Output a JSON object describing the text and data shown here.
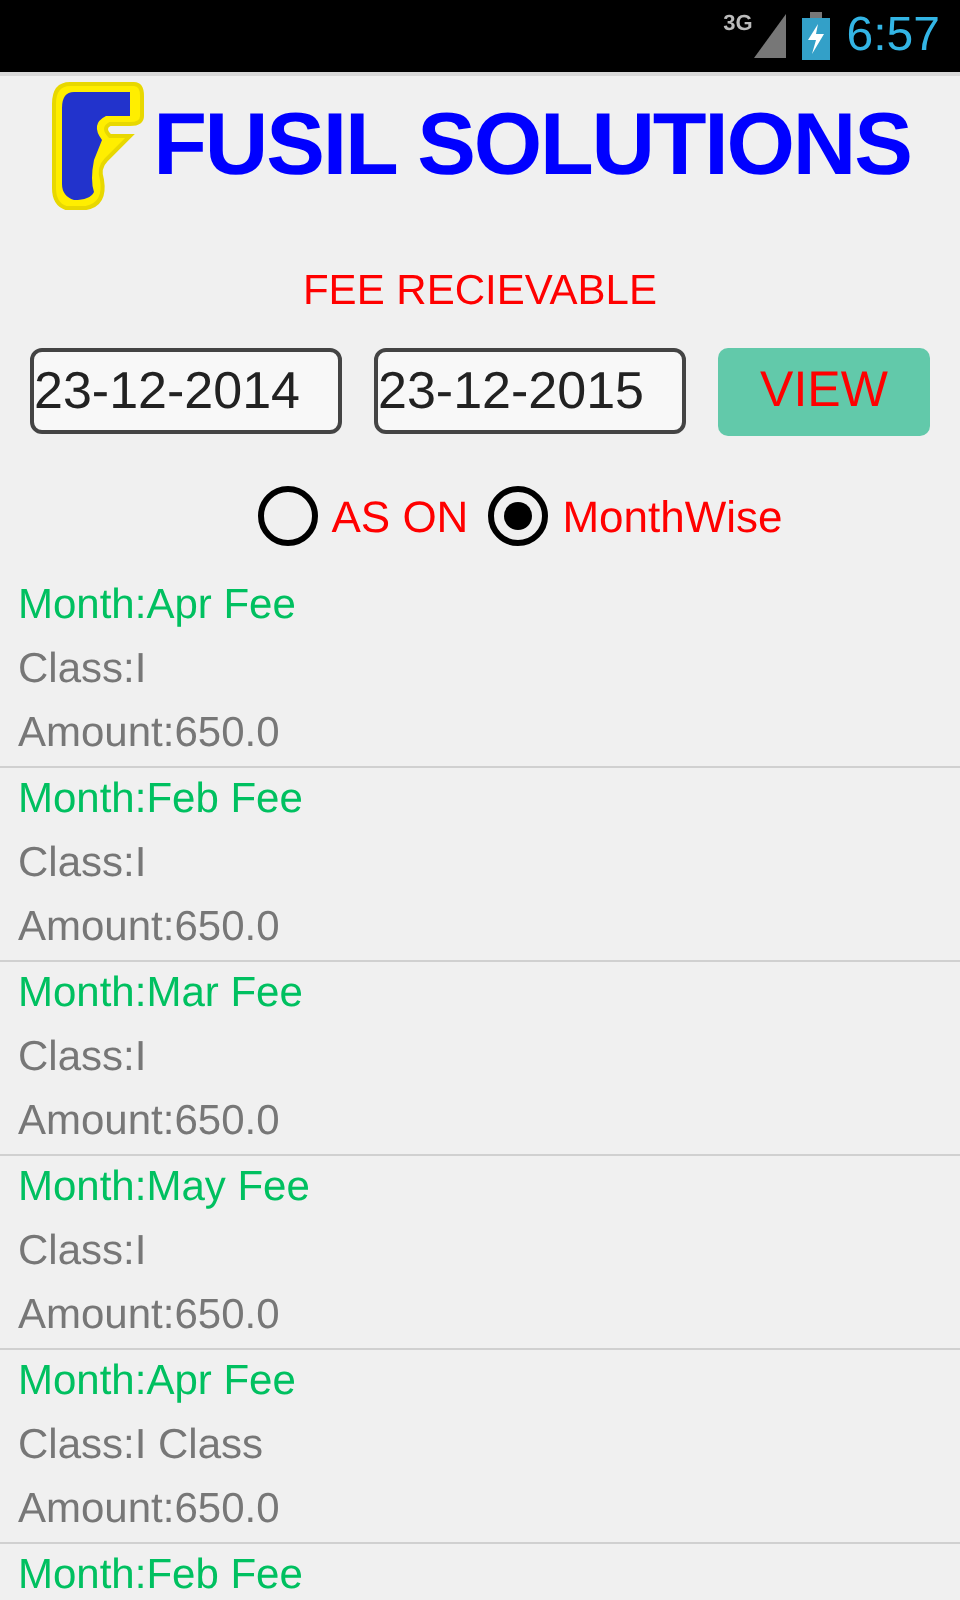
{
  "status_bar": {
    "network": "3G",
    "time": "6:57"
  },
  "header": {
    "brand": "FUSIL SOLUTIONS"
  },
  "title": "FEE RECIEVABLE",
  "date_from": {
    "value": "23-12-2014"
  },
  "date_to": {
    "value": "23-12-2015"
  },
  "view_button": "VIEW",
  "mode_options": [
    {
      "label": "AS ON",
      "selected": false
    },
    {
      "label": "MonthWise",
      "selected": true
    }
  ],
  "fees": [
    {
      "month": "Month:Apr Fee",
      "class": "Class:I",
      "amount": "Amount:650.0"
    },
    {
      "month": "Month:Feb Fee",
      "class": "Class:I",
      "amount": "Amount:650.0"
    },
    {
      "month": "Month:Mar Fee",
      "class": "Class:I",
      "amount": "Amount:650.0"
    },
    {
      "month": "Month:May Fee",
      "class": "Class:I",
      "amount": "Amount:650.0"
    },
    {
      "month": "Month:Apr Fee",
      "class": "Class:I Class",
      "amount": "Amount:650.0"
    },
    {
      "month": "Month:Feb Fee"
    }
  ]
}
